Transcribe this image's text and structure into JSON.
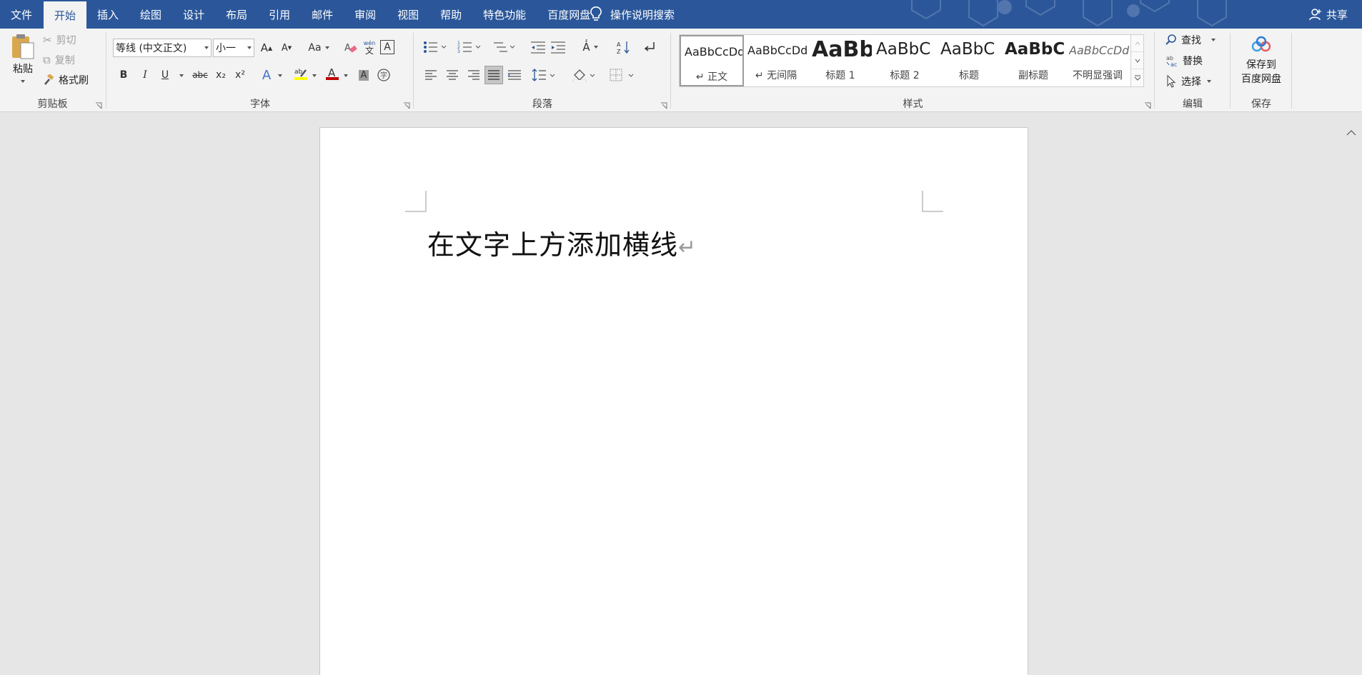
{
  "menu": {
    "file": "文件",
    "tabs": [
      "开始",
      "插入",
      "绘图",
      "设计",
      "布局",
      "引用",
      "邮件",
      "审阅",
      "视图",
      "帮助",
      "特色功能",
      "百度网盘"
    ],
    "tell_me": "操作说明搜索",
    "share": "共享"
  },
  "clipboard": {
    "paste": "粘贴",
    "cut": "剪切",
    "copy": "复制",
    "format_painter": "格式刷",
    "label": "剪贴板"
  },
  "font": {
    "name": "等线 (中文正文)",
    "size": "小一",
    "case_label": "Aa",
    "phonetic_top": "wén",
    "phonetic_bottom": "文",
    "bold": "B",
    "italic": "I",
    "underline": "U",
    "strike": "abc",
    "subscript": "x₂",
    "superscript": "x²",
    "grow": "A",
    "shrink": "A",
    "label": "字体"
  },
  "paragraph": {
    "label": "段落"
  },
  "styles": {
    "label": "样式",
    "items": [
      {
        "sample": "AaBbCcDd",
        "name": "↵ 正文"
      },
      {
        "sample": "AaBbCcDd",
        "name": "↵ 无间隔"
      },
      {
        "sample": "AaBb",
        "name": "标题 1"
      },
      {
        "sample": "AaBbC",
        "name": "标题 2"
      },
      {
        "sample": "AaBbC",
        "name": "标题"
      },
      {
        "sample": "AaBbC",
        "name": "副标题"
      },
      {
        "sample": "AaBbCcDd",
        "name": "不明显强调"
      }
    ]
  },
  "editing": {
    "find": "查找",
    "replace": "替换",
    "select": "选择",
    "label": "编辑"
  },
  "save": {
    "button_line1": "保存到",
    "button_line2": "百度网盘",
    "label": "保存"
  },
  "document": {
    "text": "在文字上方添加横线",
    "paragraph_mark": "↵"
  },
  "colors": {
    "ribbon_blue": "#2b579a",
    "highlight": "#ffff00",
    "font_color": "#c00000"
  }
}
